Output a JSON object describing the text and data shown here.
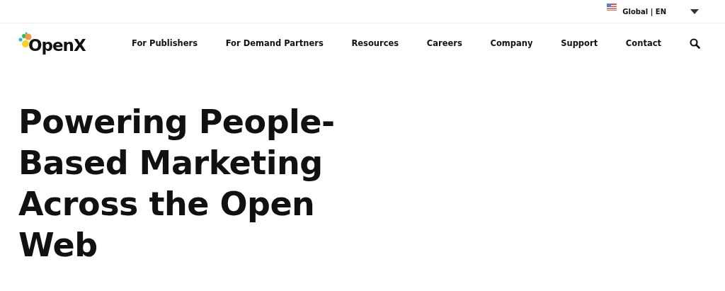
{
  "locale": {
    "label": "Global | EN"
  },
  "logo": {
    "text": "OpenX"
  },
  "nav": [
    {
      "label": "For Publishers"
    },
    {
      "label": "For Demand Partners"
    },
    {
      "label": "Resources"
    },
    {
      "label": "Careers"
    },
    {
      "label": "Company"
    },
    {
      "label": "Support"
    },
    {
      "label": "Contact"
    }
  ],
  "hero": {
    "headline": "Powering People-Based Marketing Across the Open Web"
  }
}
